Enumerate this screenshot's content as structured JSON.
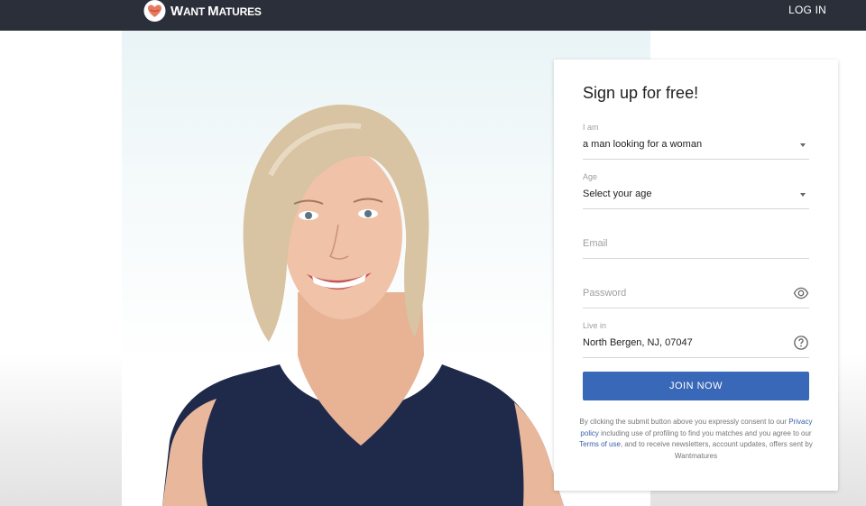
{
  "header": {
    "logo_text_big_1": "W",
    "logo_text_small_1": "ANT ",
    "logo_text_big_2": "M",
    "logo_text_small_2": "ATURES",
    "login_label": "LOG IN"
  },
  "signup": {
    "title": "Sign up for free!",
    "iam": {
      "label": "I am",
      "value": "a man looking for a woman"
    },
    "age": {
      "label": "Age",
      "value": "Select your age"
    },
    "email": {
      "placeholder": "Email"
    },
    "password": {
      "placeholder": "Password"
    },
    "location": {
      "label": "Live in",
      "value": "North Bergen, NJ, 07047"
    },
    "join_label": "JOIN NOW",
    "legal": {
      "part1": "By clicking the submit button above you expressly consent to our ",
      "privacy_link": "Privacy policy",
      "part2": " including use of profiling to find you matches and you agree to our ",
      "terms_link": "Terms of use",
      "part3": ", and to receive newsletters, account updates, offers sent by Wantmatures"
    }
  },
  "colors": {
    "topbar": "#2b2f3a",
    "button": "#3a68b8",
    "link": "#3a5fa8",
    "logo_heart": "#e8795f",
    "dress": "#1f2a4a",
    "hair": "#d8c3a2"
  },
  "icons": {
    "logo": "heart-lips-icon",
    "password_toggle": "eye-icon",
    "location_help": "question-circle-icon",
    "select_arrow": "caret-down-icon"
  }
}
